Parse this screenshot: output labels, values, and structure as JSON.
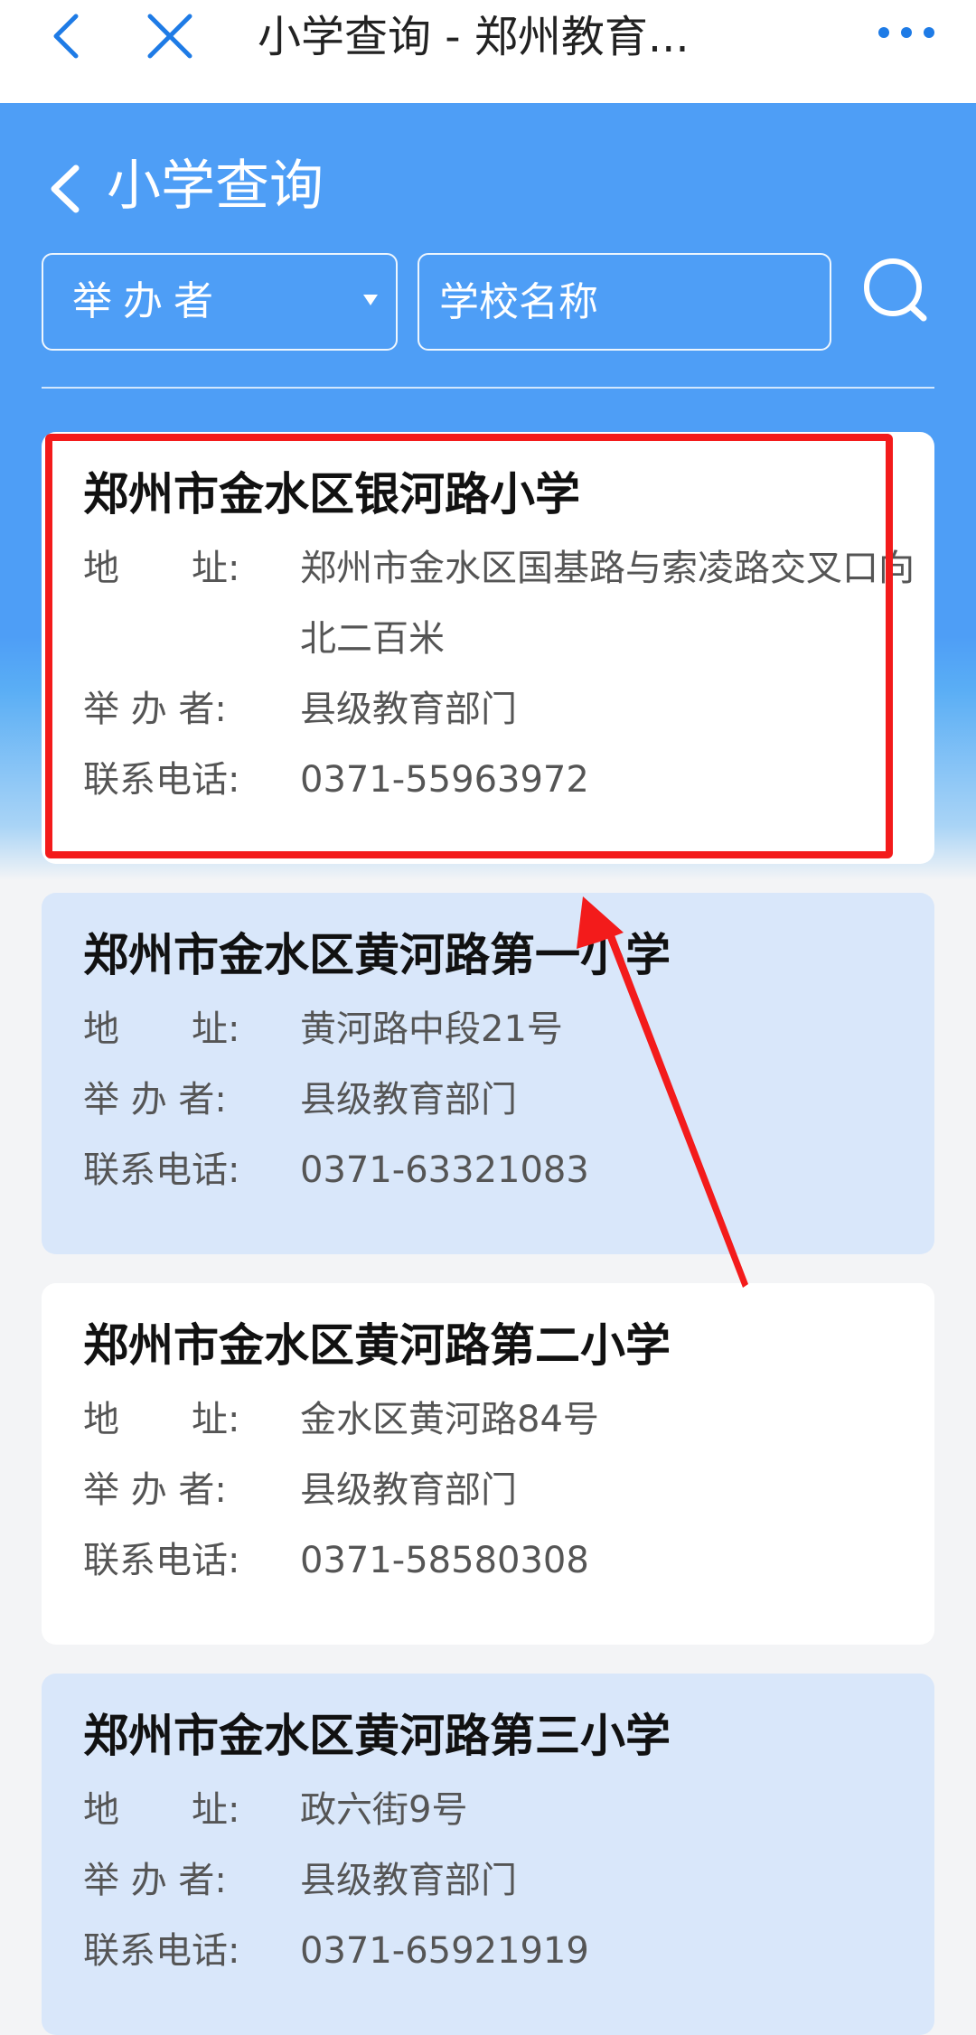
{
  "browser": {
    "title": "小学查询 - 郑州教育..."
  },
  "page": {
    "title": "小学查询"
  },
  "filters": {
    "sponsor_select": "举办者",
    "name_placeholder": "学校名称"
  },
  "labels": {
    "address": "地　　址:",
    "sponsor": "举 办 者:",
    "phone": "联系电话:"
  },
  "schools": [
    {
      "name": "郑州市金水区银河路小学",
      "address": "郑州市金水区国基路与索凌路交叉口向北二百米",
      "sponsor": "县级教育部门",
      "phone": "0371-55963972"
    },
    {
      "name": "郑州市金水区黄河路第一小学",
      "address": "黄河路中段21号",
      "sponsor": "县级教育部门",
      "phone": "0371-63321083"
    },
    {
      "name": "郑州市金水区黄河路第二小学",
      "address": "金水区黄河路84号",
      "sponsor": "县级教育部门",
      "phone": "0371-58580308"
    },
    {
      "name": "郑州市金水区黄河路第三小学",
      "address": "政六街9号",
      "sponsor": "县级教育部门",
      "phone": "0371-65921919"
    }
  ],
  "colors": {
    "header_blue": "#4e9ef6",
    "card_alt": "#d9e7fa",
    "annotation_red": "#f31b1b"
  }
}
